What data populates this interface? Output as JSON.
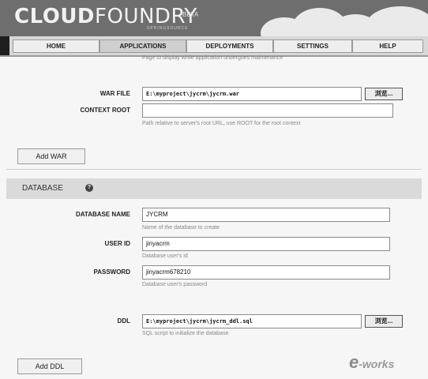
{
  "brand": {
    "logo_bold": "CLOUD",
    "logo_thin": "FOUNDRY",
    "badge": "BETA",
    "subtitle": "SPRINGSOURCE"
  },
  "nav": {
    "tabs": [
      {
        "label": "HOME"
      },
      {
        "label": "APPLICATIONS",
        "active": true
      },
      {
        "label": "DEPLOYMENTS"
      },
      {
        "label": "SETTINGS"
      },
      {
        "label": "HELP"
      }
    ]
  },
  "top_hint": "Page to display while application undergoes maintenance",
  "war": {
    "war_file_label": "WAR FILE",
    "war_file_value": "E:\\myproject\\jycrm\\jycrm.war",
    "browse_label": "浏览...",
    "context_root_label": "CONTEXT ROOT",
    "context_root_value": "",
    "context_root_hint": "Path relative to server's root URL, use ROOT for the root context",
    "add_war_label": "Add WAR"
  },
  "database": {
    "section_title": "DATABASE",
    "help_icon": "question-circle-icon",
    "name_label": "DATABASE NAME",
    "name_value": "JYCRM",
    "name_hint": "Name of the database to create",
    "user_label": "USER ID",
    "user_value": "jinyacrm",
    "user_hint": "Database user's id",
    "password_label": "PASSWORD",
    "password_value": "jinyacrm678210",
    "password_hint": "Database user's password",
    "ddl_label": "DDL",
    "ddl_value": "E:\\myproject\\jycrm\\jycrm_ddl.sql",
    "ddl_browse_label": "浏览...",
    "ddl_hint": "SQL script to initialize the database",
    "add_ddl_label": "Add DDL"
  },
  "watermark": {
    "e": "e",
    "text": "-works"
  }
}
